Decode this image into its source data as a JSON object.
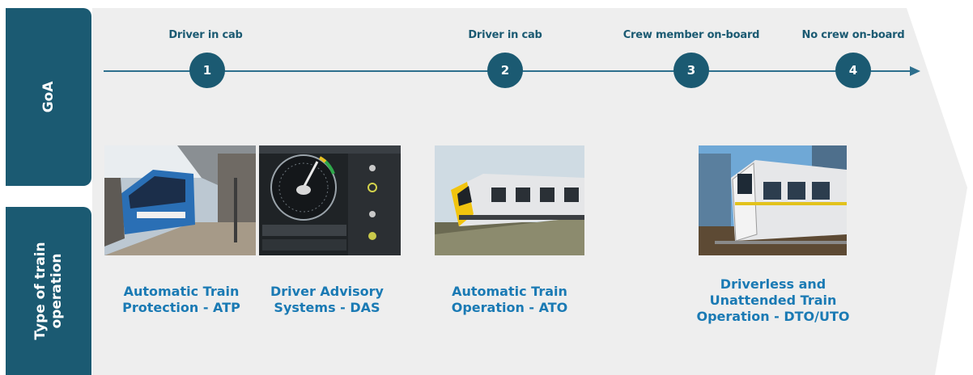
{
  "goa_tab": {
    "label": "GoA"
  },
  "operation_tab": {
    "label": "Type of train operation"
  },
  "levels": [
    {
      "number": "1",
      "label": "Driver in cab"
    },
    {
      "number": "2",
      "label": "Driver in cab"
    },
    {
      "number": "3",
      "label": "Crew member on-board"
    },
    {
      "number": "4",
      "label": "No crew on-board"
    }
  ],
  "operations": [
    {
      "line1": "Automatic Train",
      "line2": "Protection - ATP"
    },
    {
      "line1": "Driver Advisory",
      "line2": "Systems - DAS"
    },
    {
      "line1": "Automatic Train",
      "line2": "Operation - ATO"
    },
    {
      "line1": "Driverless and",
      "line2": "Unattended Train",
      "line3": "Operation - DTO/UTO"
    }
  ],
  "colors": {
    "primary": "#1b5a72",
    "caption": "#1a7ab4",
    "background": "#eeeeee"
  }
}
